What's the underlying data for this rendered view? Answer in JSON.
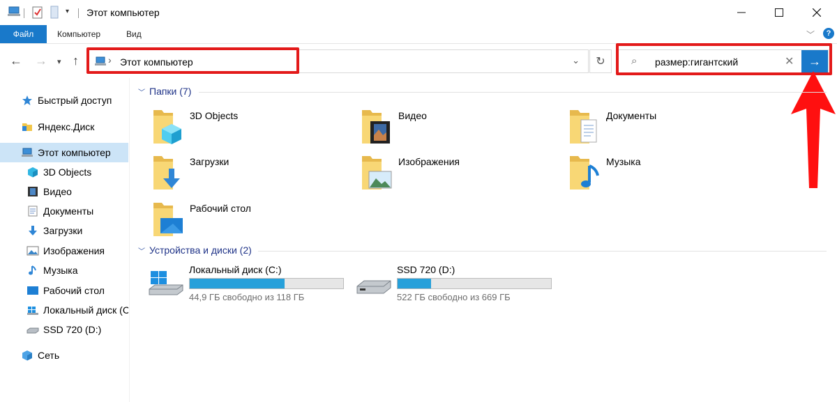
{
  "window": {
    "title": "Этот компьютер"
  },
  "ribbon": {
    "tabs": [
      "Файл",
      "Компьютер",
      "Вид"
    ]
  },
  "address": {
    "path": "Этот компьютер"
  },
  "search": {
    "query": "размер:гигантский"
  },
  "sidebar": {
    "items": [
      {
        "label": "Быстрый доступ",
        "icon": "star-icon"
      },
      {
        "label": "Яндекс.Диск",
        "icon": "yandex-disk-icon"
      },
      {
        "label": "Этот компьютер",
        "icon": "computer-icon",
        "selected": true
      },
      {
        "label": "3D Objects",
        "icon": "cube-icon"
      },
      {
        "label": "Видео",
        "icon": "video-icon"
      },
      {
        "label": "Документы",
        "icon": "document-icon"
      },
      {
        "label": "Загрузки",
        "icon": "download-icon"
      },
      {
        "label": "Изображения",
        "icon": "image-icon"
      },
      {
        "label": "Музыка",
        "icon": "music-icon"
      },
      {
        "label": "Рабочий стол",
        "icon": "desktop-icon"
      },
      {
        "label": "Локальный диск (C",
        "icon": "windows-drive-icon"
      },
      {
        "label": "SSD 720 (D:)",
        "icon": "drive-icon"
      },
      {
        "label": "Сеть",
        "icon": "network-icon"
      }
    ]
  },
  "main": {
    "folders_header": "Папки (7)",
    "folders": [
      {
        "label": "3D Objects",
        "icon": "cube-folder-icon"
      },
      {
        "label": "Видео",
        "icon": "video-folder-icon"
      },
      {
        "label": "Документы",
        "icon": "documents-folder-icon"
      },
      {
        "label": "Загрузки",
        "icon": "downloads-folder-icon"
      },
      {
        "label": "Изображения",
        "icon": "images-folder-icon"
      },
      {
        "label": "Музыка",
        "icon": "music-folder-icon"
      },
      {
        "label": "Рабочий стол",
        "icon": "desktop-folder-icon"
      }
    ],
    "drives_header": "Устройства и диски (2)",
    "drives": [
      {
        "label": "Локальный диск (C:)",
        "free": "44,9 ГБ свободно из 118 ГБ",
        "used_fraction": 0.62,
        "icon": "windows-drive-icon"
      },
      {
        "label": "SSD 720 (D:)",
        "free": "522 ГБ свободно из 669 ГБ",
        "used_fraction": 0.22,
        "icon": "drive-icon"
      }
    ]
  },
  "colors": {
    "accent": "#1979ca",
    "highlight": "#e31a1a",
    "selection": "#cce4f7",
    "drive_fill": "#26a0da"
  }
}
